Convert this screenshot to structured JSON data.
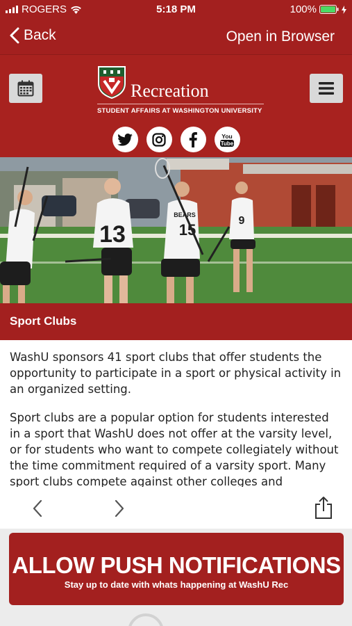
{
  "status_bar": {
    "carrier": "ROGERS",
    "time": "5:18 PM",
    "battery": "100%"
  },
  "nav": {
    "back_label": "Back",
    "open_label": "Open in Browser"
  },
  "header": {
    "logo_word": "Recreation",
    "logo_subtitle": "STUDENT AFFAIRS AT WASHINGTON UNIVERSITY",
    "social_icons": [
      "twitter-icon",
      "instagram-icon",
      "facebook-icon",
      "youtube-icon"
    ],
    "youtube_line1": "You",
    "youtube_line2": "Tube"
  },
  "hero": {
    "jersey_numbers": [
      "13",
      "15",
      "9"
    ],
    "jersey_text": "BEARS"
  },
  "section": {
    "title": "Sport Clubs"
  },
  "content": {
    "paragraphs": [
      "WashU sponsors 41 sport clubs that offer students the opportunity to participate in a sport or physical activity in an organized setting.",
      "Sport clubs are a popular option for students interested in a sport that WashU does not offer at the varsity level, or for students who want to compete collegiately without the time commitment required of a varsity sport. Many sport clubs compete against other colleges and universities at"
    ]
  },
  "promo": {
    "title": "ALLOW PUSH NOTIFICATIONS",
    "subtitle": "Stay up to date with whats happening at WashU Rec"
  },
  "colors": {
    "brand_red": "#a3201f",
    "button_gray": "#d9d9d9",
    "battery_green": "#4cd964"
  }
}
